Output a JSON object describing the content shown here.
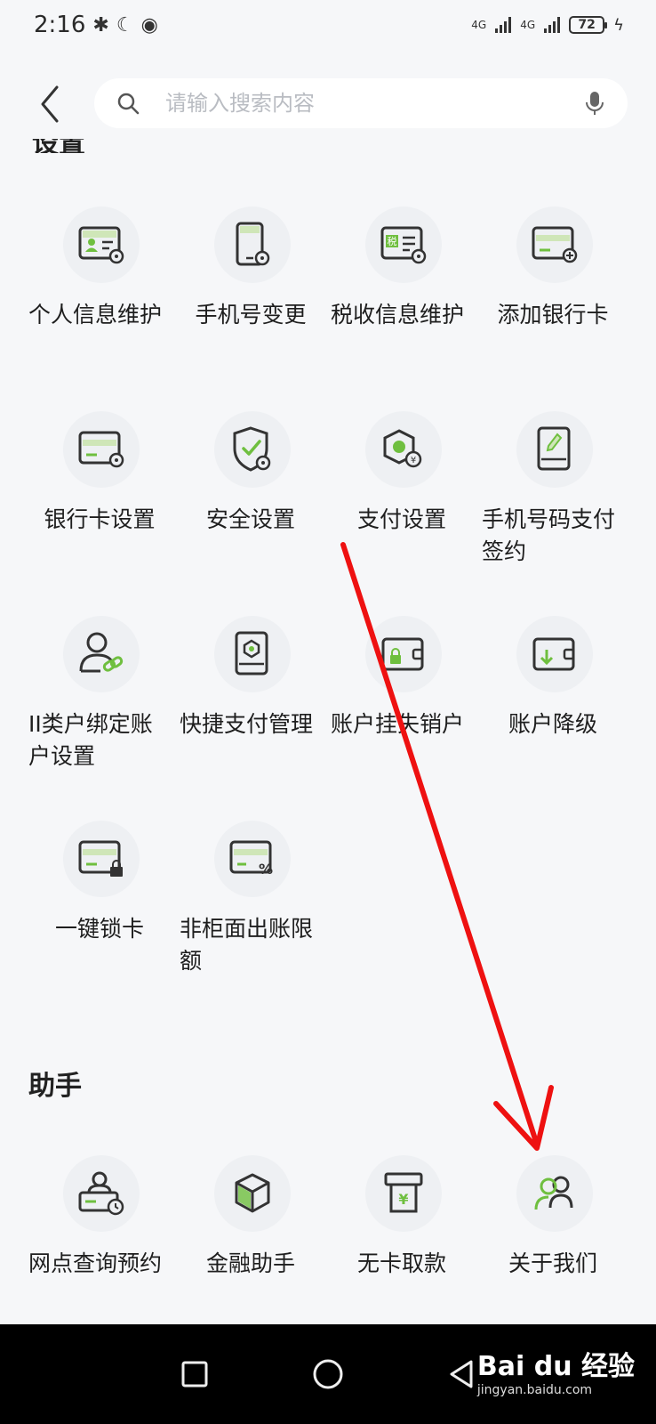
{
  "status_bar": {
    "time": "2:16",
    "net_1": "4G",
    "net_2": "4G",
    "battery": "72"
  },
  "search": {
    "placeholder": "请输入搜索内容"
  },
  "sections": {
    "settings_title_cut": "设置",
    "assistant_title": "助手"
  },
  "settings_items": [
    {
      "label": "个人信息维护"
    },
    {
      "label": "手机号变更"
    },
    {
      "label": "税收信息维护",
      "badge": "税"
    },
    {
      "label": "添加银行卡"
    },
    {
      "label": "银行卡设置"
    },
    {
      "label": "安全设置"
    },
    {
      "label": "支付设置",
      "badge": "¥"
    },
    {
      "label": "手机号码支付签约"
    },
    {
      "label": "II类户绑定账户设置"
    },
    {
      "label": "快捷支付管理"
    },
    {
      "label": "账户挂失销户"
    },
    {
      "label": "账户降级"
    },
    {
      "label": "一键锁卡"
    },
    {
      "label": "非柜面出账限额",
      "badge": "%"
    }
  ],
  "assistant_items": [
    {
      "label": "网点查询预约"
    },
    {
      "label": "金融助手"
    },
    {
      "label": "无卡取款",
      "badge": "¥"
    },
    {
      "label": "关于我们"
    }
  ],
  "watermark": {
    "brand": "Bai du 经验",
    "url": "jingyan.baidu.com"
  },
  "colors": {
    "accent_green": "#6fbf3f",
    "icon_stroke": "#333333",
    "arrow_red": "#ee1111"
  }
}
